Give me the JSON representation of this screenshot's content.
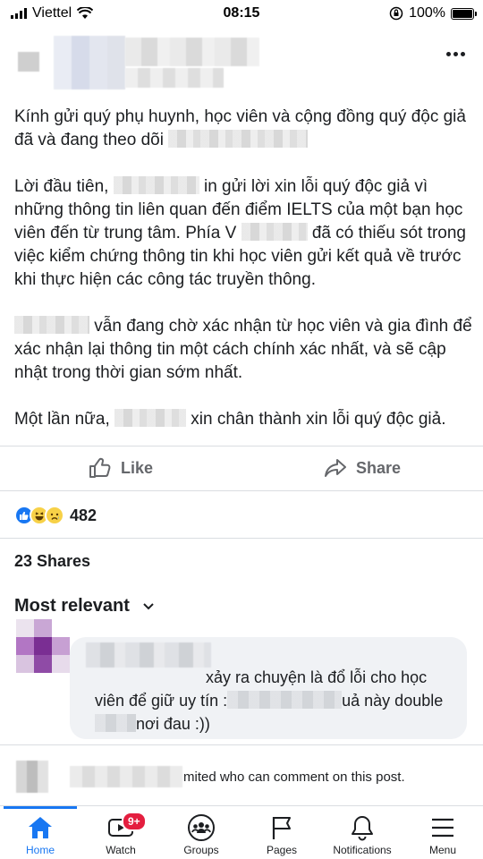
{
  "status": {
    "carrier": "Viettel",
    "time": "08:15",
    "battery_text": "100%",
    "battery_level": 1.0
  },
  "post": {
    "paragraphs": [
      {
        "before": "Kính gửi quý phụ huynh, học viên và cộng đồng quý độc giả đã và đang theo dõi",
        "after": ""
      },
      {
        "before": "Lời đầu tiên,",
        "after": "in gửi lời xin lỗi quý độc giả vì những thông tin liên quan đến điểm IELTS của một bạn học viên đến từ trung tâm. Phía V",
        "after2": "đã có thiếu sót trong việc kiểm chứng thông tin khi học viên gửi kết quả về trước khi thực hiện các công tác truyền thông."
      },
      {
        "before": "",
        "after": "vẫn đang chờ xác nhận từ học viên và gia đình để xác nhận lại thông tin một cách chính xác nhất, và sẽ cập nhật trong thời gian sớm nhất."
      },
      {
        "before": "Một lần nữa,",
        "after": "xin chân thành xin lỗi quý độc giả."
      }
    ]
  },
  "actions": {
    "like_label": "Like",
    "share_label": "Share"
  },
  "reactions": {
    "count": "482"
  },
  "shares": {
    "label": "23 Shares"
  },
  "comments": {
    "sort_label": "Most relevant",
    "first_comment_text_1": "xảy ra chuyện là đổ lỗi cho học",
    "first_comment_text_2": "viên để giữ uy tín :",
    "first_comment_text_3": "uả này double",
    "first_comment_text_4": "nơi đau :))",
    "limit_text": "mited who can comment on this post."
  },
  "tabs": [
    {
      "label": "Home",
      "icon": "home-icon"
    },
    {
      "label": "Watch",
      "icon": "watch-icon",
      "badge": "9+"
    },
    {
      "label": "Groups",
      "icon": "groups-icon"
    },
    {
      "label": "Pages",
      "icon": "pages-icon"
    },
    {
      "label": "Notifications",
      "icon": "bell-icon"
    },
    {
      "label": "Menu",
      "icon": "menu-icon"
    }
  ],
  "colors": {
    "brand": "#1877f2",
    "text": "#1c1e21",
    "secondary": "#65676b",
    "badge": "#e41e3f"
  }
}
